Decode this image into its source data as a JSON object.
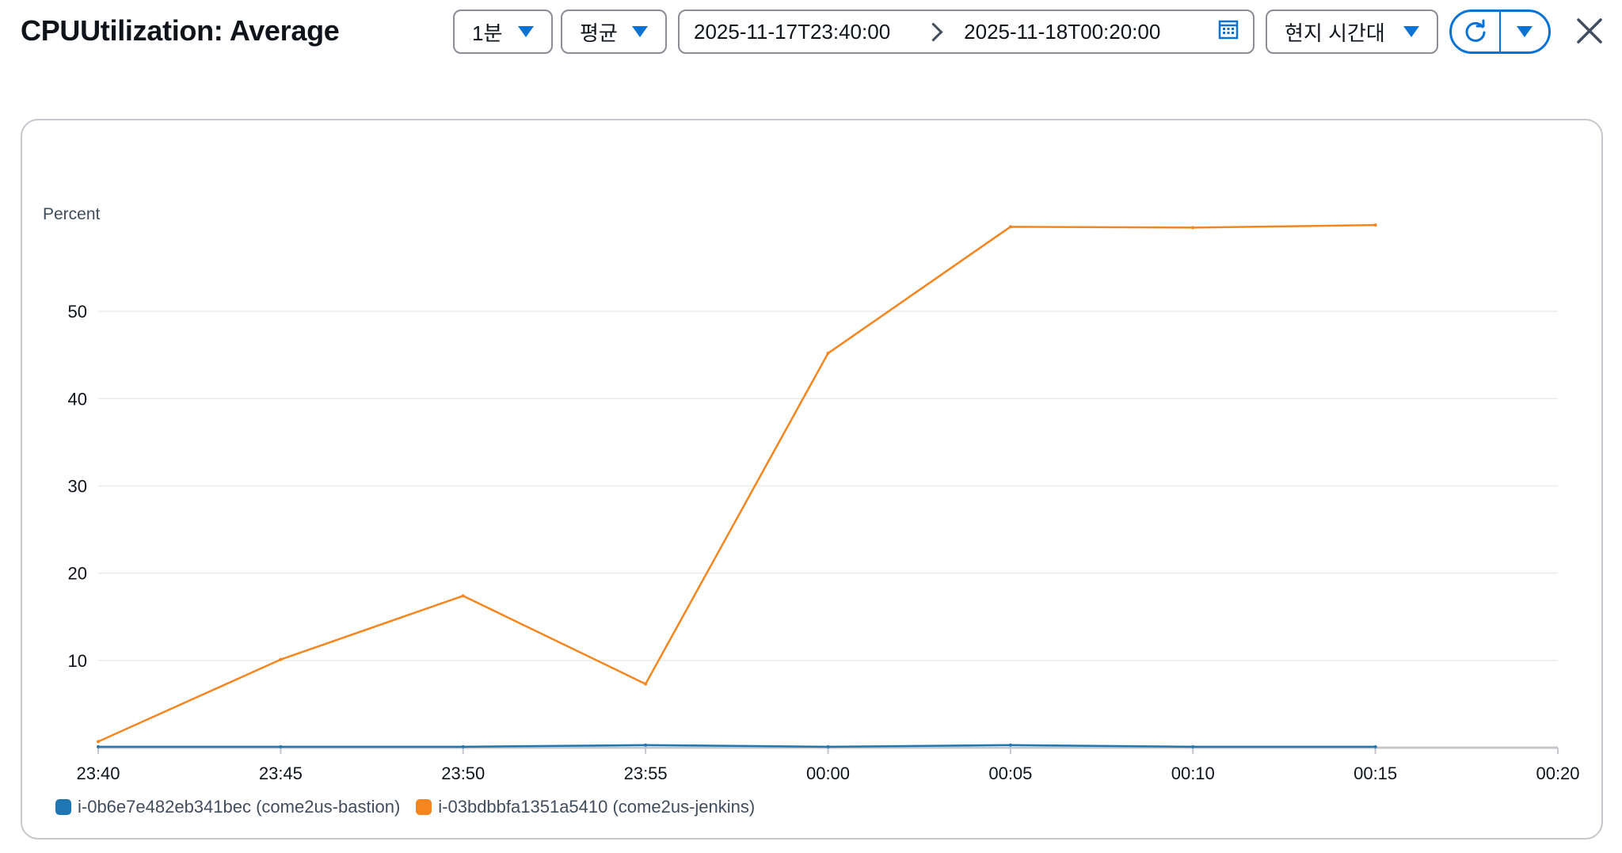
{
  "header": {
    "title": "CPUUtilization: Average",
    "period": "1분",
    "statistic": "평균",
    "range_start": "2025-11-17T23:40:00",
    "range_end": "2025-11-18T00:20:00",
    "timezone": "현지 시간대"
  },
  "icons": {
    "calendar": "calendar-icon",
    "refresh": "refresh-icon",
    "dropdown": "caret-down-icon",
    "close": "close-icon"
  },
  "colors": {
    "accent": "#0972d3",
    "series_bastion": "#1f77b4",
    "series_jenkins": "#f5861f"
  },
  "chart_data": {
    "type": "line",
    "ylabel": "Percent",
    "x": [
      "23:40",
      "23:45",
      "23:50",
      "23:55",
      "00:00",
      "00:05",
      "00:10",
      "00:15",
      "00:20"
    ],
    "yticks": [
      10,
      20,
      30,
      40,
      50
    ],
    "ylim": [
      0,
      61
    ],
    "grid": true,
    "legend_position": "bottom-left",
    "series": [
      {
        "name": "i-0b6e7e482eb341bec (come2us-bastion)",
        "color": "#1f77b4",
        "values": [
          0.1,
          0.1,
          0.1,
          0.3,
          0.1,
          0.3,
          0.1,
          0.1
        ]
      },
      {
        "name": "i-03bdbbfa1351a5410 (come2us-jenkins)",
        "color": "#f5861f",
        "values": [
          0.7,
          10.1,
          17.4,
          7.3,
          45.2,
          59.7,
          59.6,
          59.9
        ]
      }
    ]
  }
}
